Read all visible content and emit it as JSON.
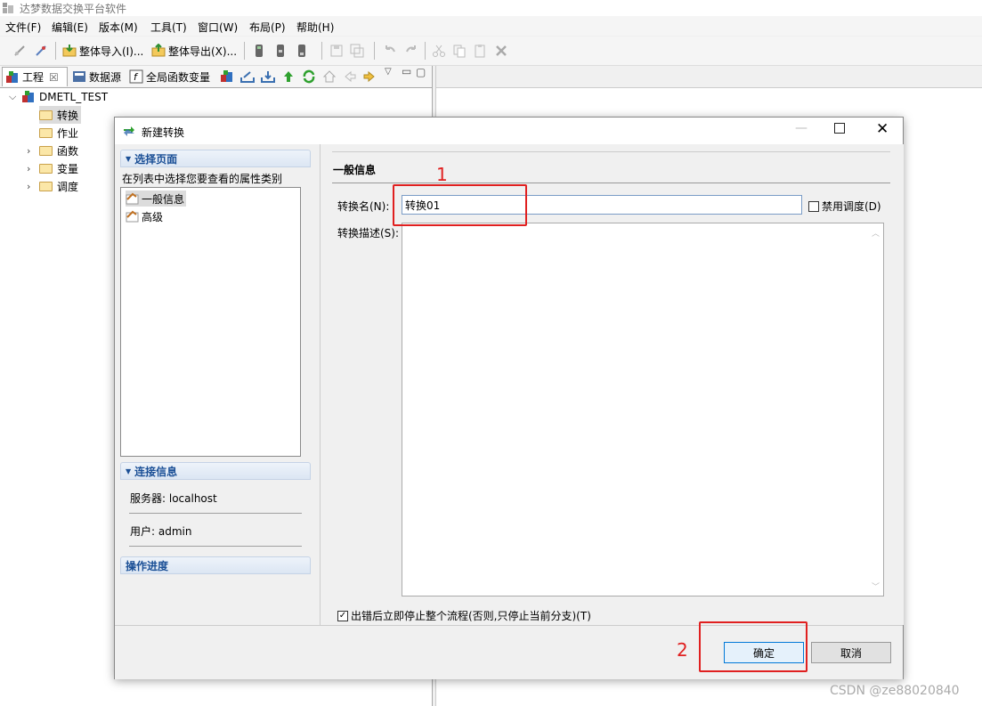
{
  "window": {
    "title": "达梦数据交换平台软件"
  },
  "menu": [
    "文件(F)",
    "编辑(E)",
    "版本(M)",
    "工具(T)",
    "窗口(W)",
    "布局(P)",
    "帮助(H)"
  ],
  "toolbar": {
    "import_label": "整体导入(I)...",
    "export_label": "整体导出(X)..."
  },
  "left_tabs": {
    "project": "工程",
    "datasource": "数据源",
    "global_vars": "全局函数变量"
  },
  "tree": {
    "root": "DMETL_TEST",
    "children": [
      "转换",
      "作业",
      "函数",
      "变量",
      "调度"
    ]
  },
  "dialog": {
    "title": "新建转换",
    "select_page_header": "选择页面",
    "select_page_hint": "在列表中选择您要查看的属性类别",
    "pages": [
      "一般信息",
      "高级"
    ],
    "conn_header": "连接信息",
    "server_label": "服务器: localhost",
    "user_label": "用户: admin",
    "progress_header": "操作进度",
    "section_title": "一般信息",
    "name_label": "转换名(N):",
    "name_value": "转换01",
    "disable_schedule_label": "禁用调度(D)",
    "desc_label": "转换描述(S):",
    "stop_on_error_label": "出错后立即停止整个流程(否则,只停止当前分支)(T)",
    "ok_label": "确定",
    "cancel_label": "取消"
  },
  "annotations": {
    "num1": "1",
    "num2": "2"
  },
  "watermark": "CSDN @ze88020840",
  "colors": {
    "accent": "#1a4f96",
    "annotation_red": "#e02020",
    "selection": "#dcdcdc"
  }
}
